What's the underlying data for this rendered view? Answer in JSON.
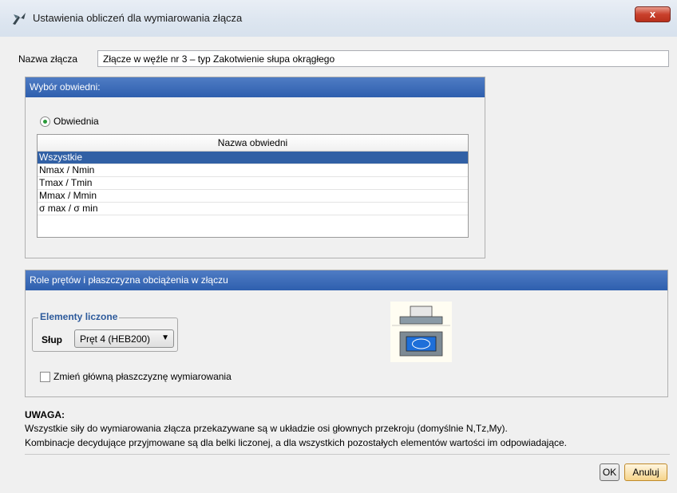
{
  "window": {
    "title": "Ustawienia obliczeń dla wymiarowania złącza",
    "close_label": "x"
  },
  "connection": {
    "label": "Nazwa złącza",
    "value": "Złącze w węźle nr 3 – typ Zakotwienie słupa okrągłego"
  },
  "envelope_group": {
    "header": "Wybór obwiedni:",
    "radio_label": "Obwiednia",
    "radio_selected": true,
    "table": {
      "column_header": "Nazwa obwiedni",
      "rows": [
        "Wszystkie",
        "Nmax / Nmin",
        "Tmax / Tmin",
        "Mmax / Mmin",
        "σ max / σ min"
      ],
      "selected_index": 0
    }
  },
  "roles_group": {
    "header": "Role prętów i płaszczyzna obciążenia w złączu",
    "elements_legend": "Elementy liczone",
    "slup_label": "Słup",
    "slup_value": "Pręt 4 (HEB200)",
    "checkbox_label": "Zmień główną płaszczyznę wymiarowania",
    "checkbox_checked": false
  },
  "note": {
    "title": "UWAGA:",
    "line1": "Wszystkie siły do wymiarowania złącza przekazywane są w układzie osi głownych przekroju (domyślnie N,Tz,My).",
    "line2": "Kombinacje decydujące przyjmowane są dla belki liczonej, a dla wszystkich pozostałych elementów wartości im odpowiadające."
  },
  "buttons": {
    "ok": "OK",
    "cancel": "Anuluj"
  },
  "colors": {
    "header_blue": "#3a69b6",
    "selection_blue": "#3160a5",
    "legend_blue": "#2d5a9b",
    "radio_green": "#2a9a3a"
  }
}
